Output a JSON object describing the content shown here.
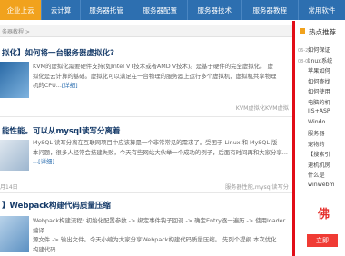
{
  "nav": {
    "items": [
      "企业上云",
      "云计算",
      "服务器托管",
      "服务器配置",
      "服务器技术",
      "服务器教程",
      "常用软件"
    ],
    "active_index": 0
  },
  "breadcrumb": "务器教程 >",
  "articles": [
    {
      "title": "拟化】如何将一台服务器虚拟化?",
      "summary_lines": [
        "KVM的虚拟化需要硬件支持(如Intel VT技术或者AMD V技术)。是基于硬件的完全虚拟化。 虚",
        "拟化是云计算的基础。虚拟化可以满足在一台物理的服务器上运行多个虚拟机，虚拟机共享物理",
        "机的CPU..."
      ],
      "more": "[详细]",
      "meta_left": "",
      "meta_right": "KVM虚拟化KVM虚拟"
    },
    {
      "title": "能性能。可以从mysql读写分离着",
      "summary_lines": [
        "MySQL 读写分离在互联网项目中应该算是一个非常常见的需求了。受困于 Linux 和 MySQL 版",
        "本问题，很多人经常会搭建失败，今天有些网站大伙举一个成功的例子，后面有时间再和大家分享...",
        "...[详细]"
      ],
      "more": "",
      "meta_left": "月14日",
      "meta_right": "服务器性能,mysql读写分"
    },
    {
      "title": "】Webpack构建代码质量压缩",
      "summary_lines": [
        "Webpack构建流程: 初始化配置参数 -> 绑定事件钩子回调 -> 确定Entry逐一遍历 -> 使用loader编译",
        "源文件 -> 输出文件。今天小编为大家分享Webpack构建代码质量压缩。 先列个提纲 本次优化",
        "构建代码..."
      ],
      "more": "",
      "meta_left": "",
      "meta_right": ""
    }
  ],
  "sidebar": {
    "title": "热点推荐",
    "rows": [
      {
        "date": "06-20",
        "text": "如何保证"
      },
      {
        "date": "08-02",
        "text": "linux系统"
      },
      {
        "date": "",
        "text": "苹果如何"
      },
      {
        "date": "",
        "text": "如何查找"
      },
      {
        "date": "",
        "text": "如何使用"
      },
      {
        "date": "",
        "text": "电脑的机"
      },
      {
        "date": "",
        "text": "IIS+ASP"
      },
      {
        "date": "",
        "text": "Windo"
      },
      {
        "date": "",
        "text": "服务器"
      },
      {
        "date": "",
        "text": "宠物的"
      },
      {
        "date": "",
        "text": "【搜索引"
      },
      {
        "date": "",
        "text": "速机机房"
      },
      {
        "date": "",
        "text": "什么是"
      },
      {
        "date": "",
        "text": "winwebm"
      }
    ],
    "promo_text": "佛",
    "promo_button": "立即"
  }
}
